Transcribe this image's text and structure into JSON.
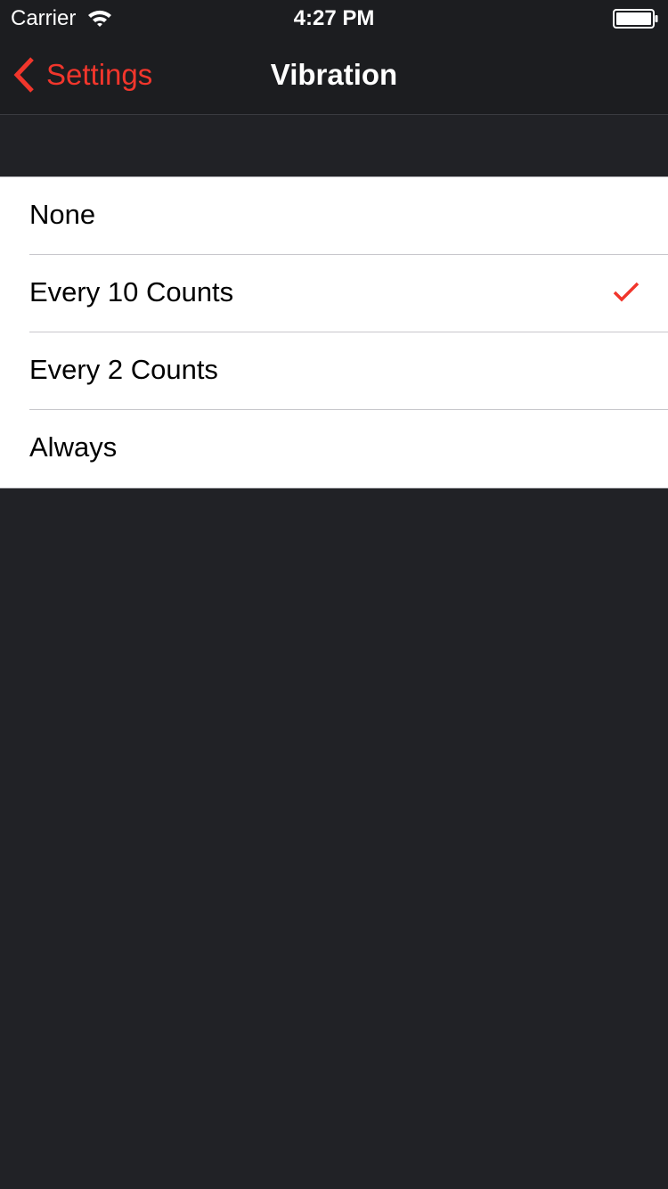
{
  "status_bar": {
    "carrier": "Carrier",
    "time": "4:27 PM",
    "icons": [
      "wifi-icon",
      "battery-icon"
    ]
  },
  "nav": {
    "back_label": "Settings",
    "title": "Vibration"
  },
  "options": [
    {
      "label": "None",
      "selected": false
    },
    {
      "label": "Every 10 Counts",
      "selected": true
    },
    {
      "label": "Every 2 Counts",
      "selected": false
    },
    {
      "label": "Always",
      "selected": false
    }
  ],
  "colors": {
    "accent": "#f1362c",
    "background": "#212226",
    "bar": "#1c1d20",
    "cell": "#ffffff"
  }
}
